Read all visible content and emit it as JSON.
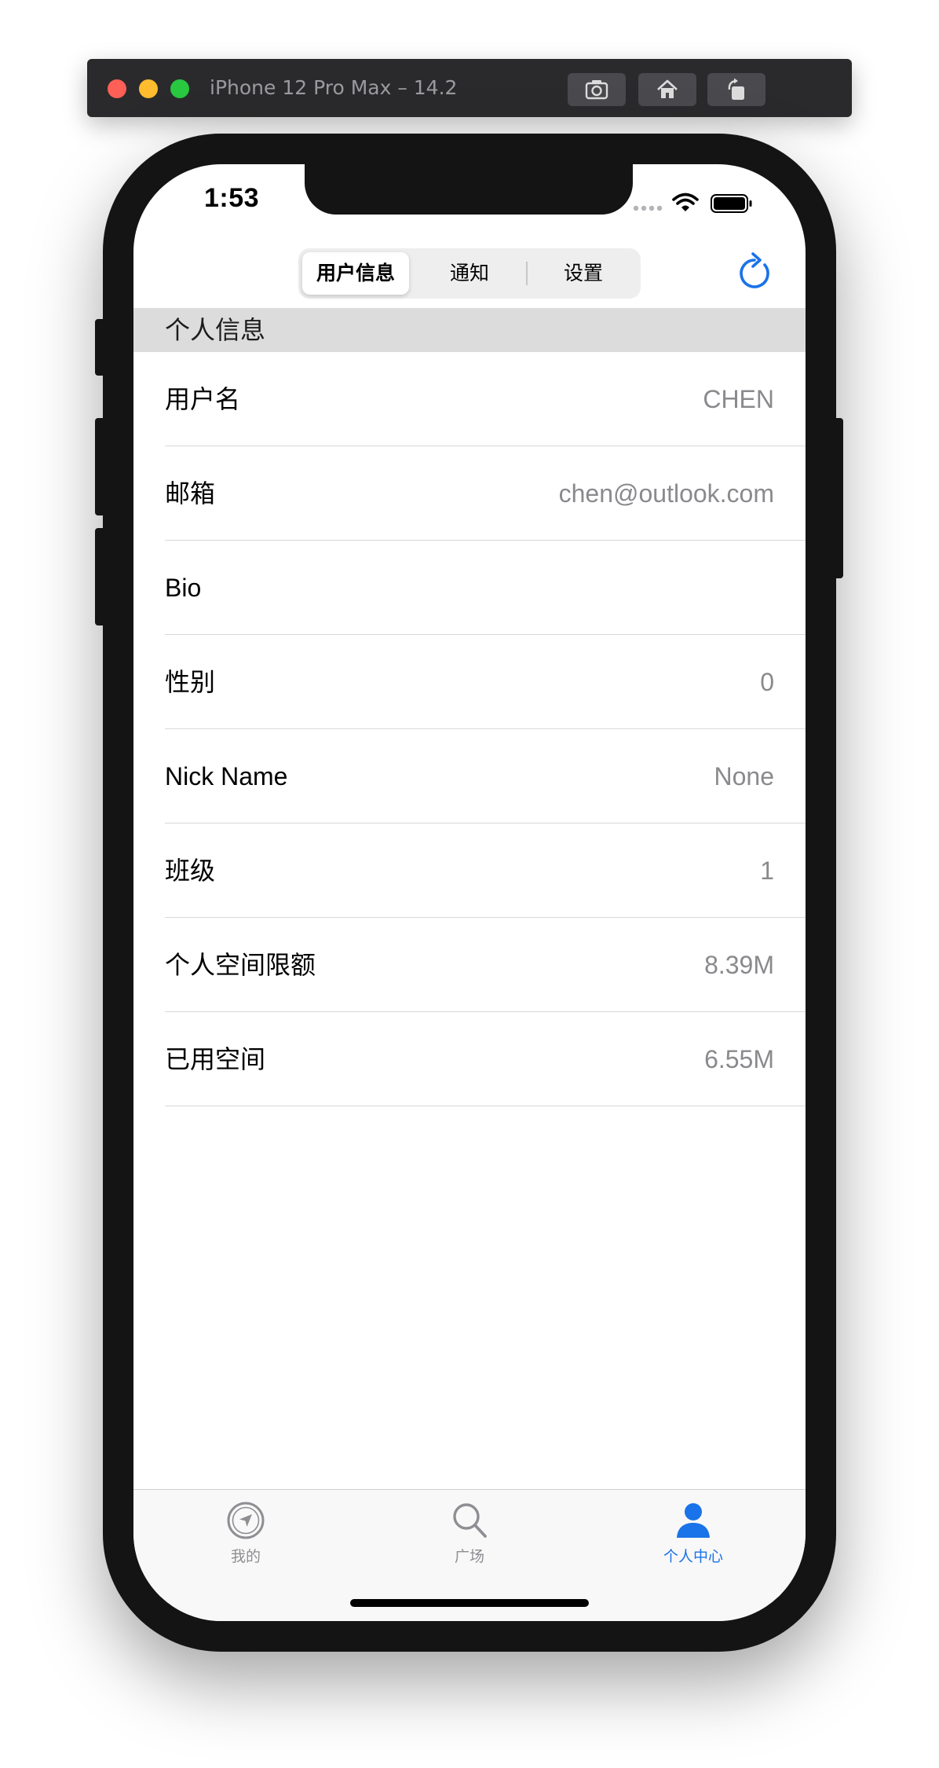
{
  "simulator": {
    "title": "iPhone 12 Pro Max – 14.2",
    "buttons": [
      "screenshot-icon",
      "home-icon",
      "rotate-icon"
    ]
  },
  "status_bar": {
    "time": "1:53",
    "icons": [
      "signal-dots-icon",
      "wifi-icon",
      "battery-icon"
    ]
  },
  "nav": {
    "segments": [
      "用户信息",
      "通知",
      "设置"
    ],
    "selected_segment": "用户信息",
    "refresh_icon": "refresh-icon",
    "accent_color": "#1a73e8"
  },
  "section": {
    "title": "个人信息"
  },
  "rows": [
    {
      "label": "用户名",
      "value": "CHEN"
    },
    {
      "label": "邮箱",
      "value": "chen@outlook.com"
    },
    {
      "label": "Bio",
      "value": ""
    },
    {
      "label": "性别",
      "value": "0"
    },
    {
      "label": "Nick Name",
      "value": "None"
    },
    {
      "label": "班级",
      "value": "1"
    },
    {
      "label": "个人空间限额",
      "value": "8.39M"
    },
    {
      "label": "已用空间",
      "value": "6.55M"
    }
  ],
  "tab_bar": {
    "tabs": [
      {
        "label": "我的",
        "icon": "compass-icon"
      },
      {
        "label": "广场",
        "icon": "search-icon"
      },
      {
        "label": "个人中心",
        "icon": "person-icon"
      }
    ],
    "active_tab": "个人中心"
  }
}
